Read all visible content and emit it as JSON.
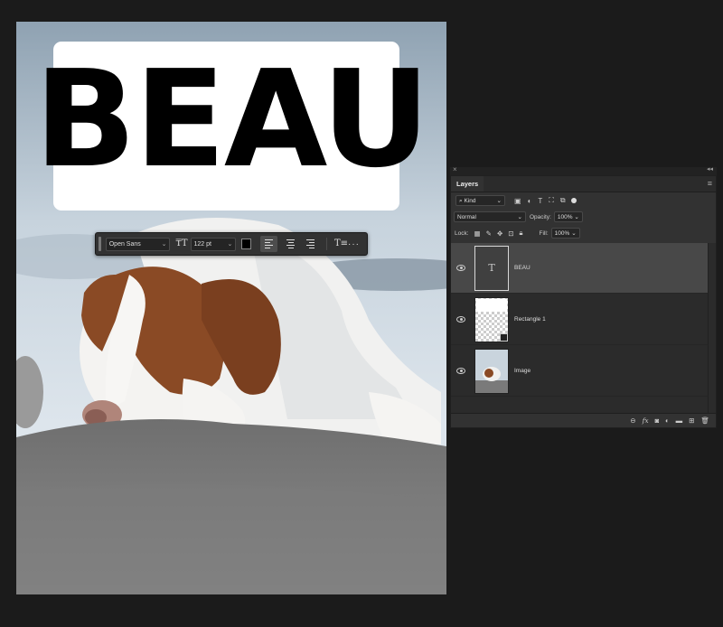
{
  "canvas": {
    "headline_text": "BEAU"
  },
  "taskbar": {
    "font_family": "Open Sans",
    "font_size": "122 pt",
    "text_color": "#000000",
    "icons": {
      "size": "text-size-icon",
      "align_left": "align-left-icon",
      "align_center": "align-center-icon",
      "align_right": "align-right-icon",
      "text_options": "text-options-icon",
      "more": "more-icon"
    },
    "more_label": "···"
  },
  "layers_panel": {
    "tab_label": "Layers",
    "filter_kind": "Kind",
    "blend_mode": "Normal",
    "opacity_label": "Opacity:",
    "opacity_value": "100%",
    "lock_label": "Lock:",
    "fill_label": "Fill:",
    "fill_value": "100%",
    "text_thumb_glyph": "T",
    "layers": [
      {
        "name": "BEAU",
        "type": "text",
        "selected": true
      },
      {
        "name": "Rectangle 1",
        "type": "shape",
        "selected": false
      },
      {
        "name": "Image",
        "type": "image",
        "selected": false
      }
    ],
    "footer_icons": [
      "link-icon",
      "fx-icon",
      "mask-icon",
      "adjustment-icon",
      "group-folder-icon",
      "new-layer-icon",
      "trash-icon"
    ],
    "fx_label": "fx"
  }
}
